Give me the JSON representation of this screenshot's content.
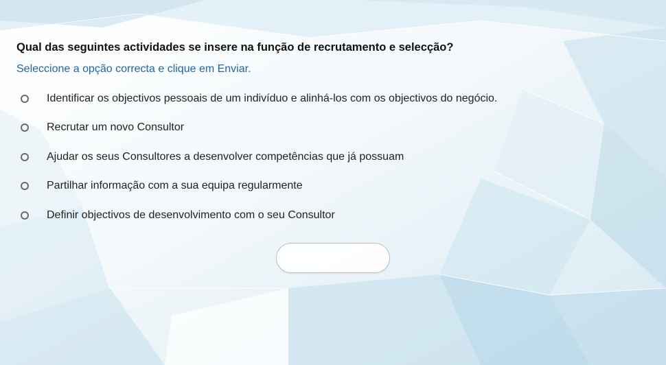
{
  "question": {
    "text": "Qual das seguintes actividades se insere na função de recrutamento e selecção?",
    "instruction": "Seleccione a opção correcta e clique em Enviar."
  },
  "options": [
    {
      "label": "Identificar os objectivos pessoais de um indivíduo e alinhá-los com os objectivos do negócio."
    },
    {
      "label": "Recrutar um novo Consultor"
    },
    {
      "label": "Ajudar os seus Consultores a desenvolver competências que já possuam"
    },
    {
      "label": "Partilhar informação com a sua equipa regularmente"
    },
    {
      "label": "Definir objectivos de desenvolvimento com o seu Consultor"
    }
  ],
  "submit_button": {
    "label": ""
  },
  "colors": {
    "question_text": "#111111",
    "instruction_text": "#1f67a0",
    "radio_border": "#6a6a6a"
  }
}
